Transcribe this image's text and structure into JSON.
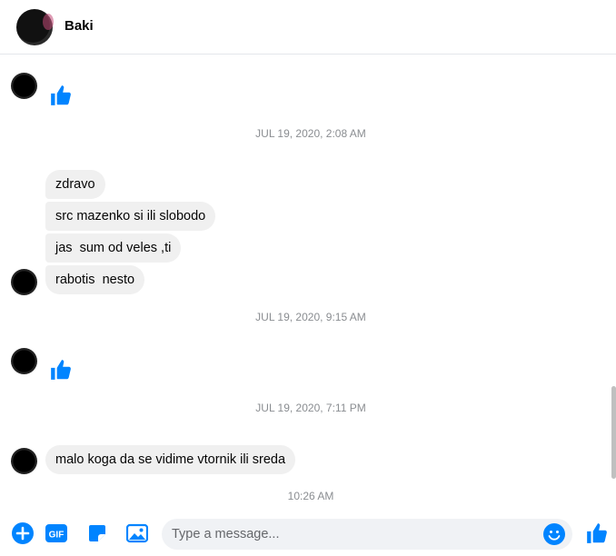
{
  "header": {
    "contact_name": "Baki"
  },
  "messages": {
    "like_1_icon": "thumbs-up-icon",
    "ts_1": "JUL 19, 2020, 2:08 AM",
    "bubble_1": "zdravo",
    "bubble_2": "src mazenko si ili slobodo",
    "bubble_3": "jas  sum od veles ,ti",
    "bubble_4": "rabotis  nesto",
    "ts_2": "JUL 19, 2020, 9:15 AM",
    "like_2_icon": "thumbs-up-icon",
    "ts_3": "JUL 19, 2020, 7:11 PM",
    "bubble_5": "malo koga da se vidime vtornik ili sreda",
    "ts_4": "10:26 AM"
  },
  "composer": {
    "placeholder": "Type a message...",
    "value": "",
    "gif_label": "GIF",
    "icons": [
      "plus-circle-icon",
      "gif-icon",
      "sticker-icon",
      "photo-icon",
      "emoji-icon",
      "thumbs-up-icon"
    ]
  },
  "colors": {
    "accent": "#0084ff",
    "bubble": "#f0f0f0",
    "timestamp": "#8a8d91"
  }
}
